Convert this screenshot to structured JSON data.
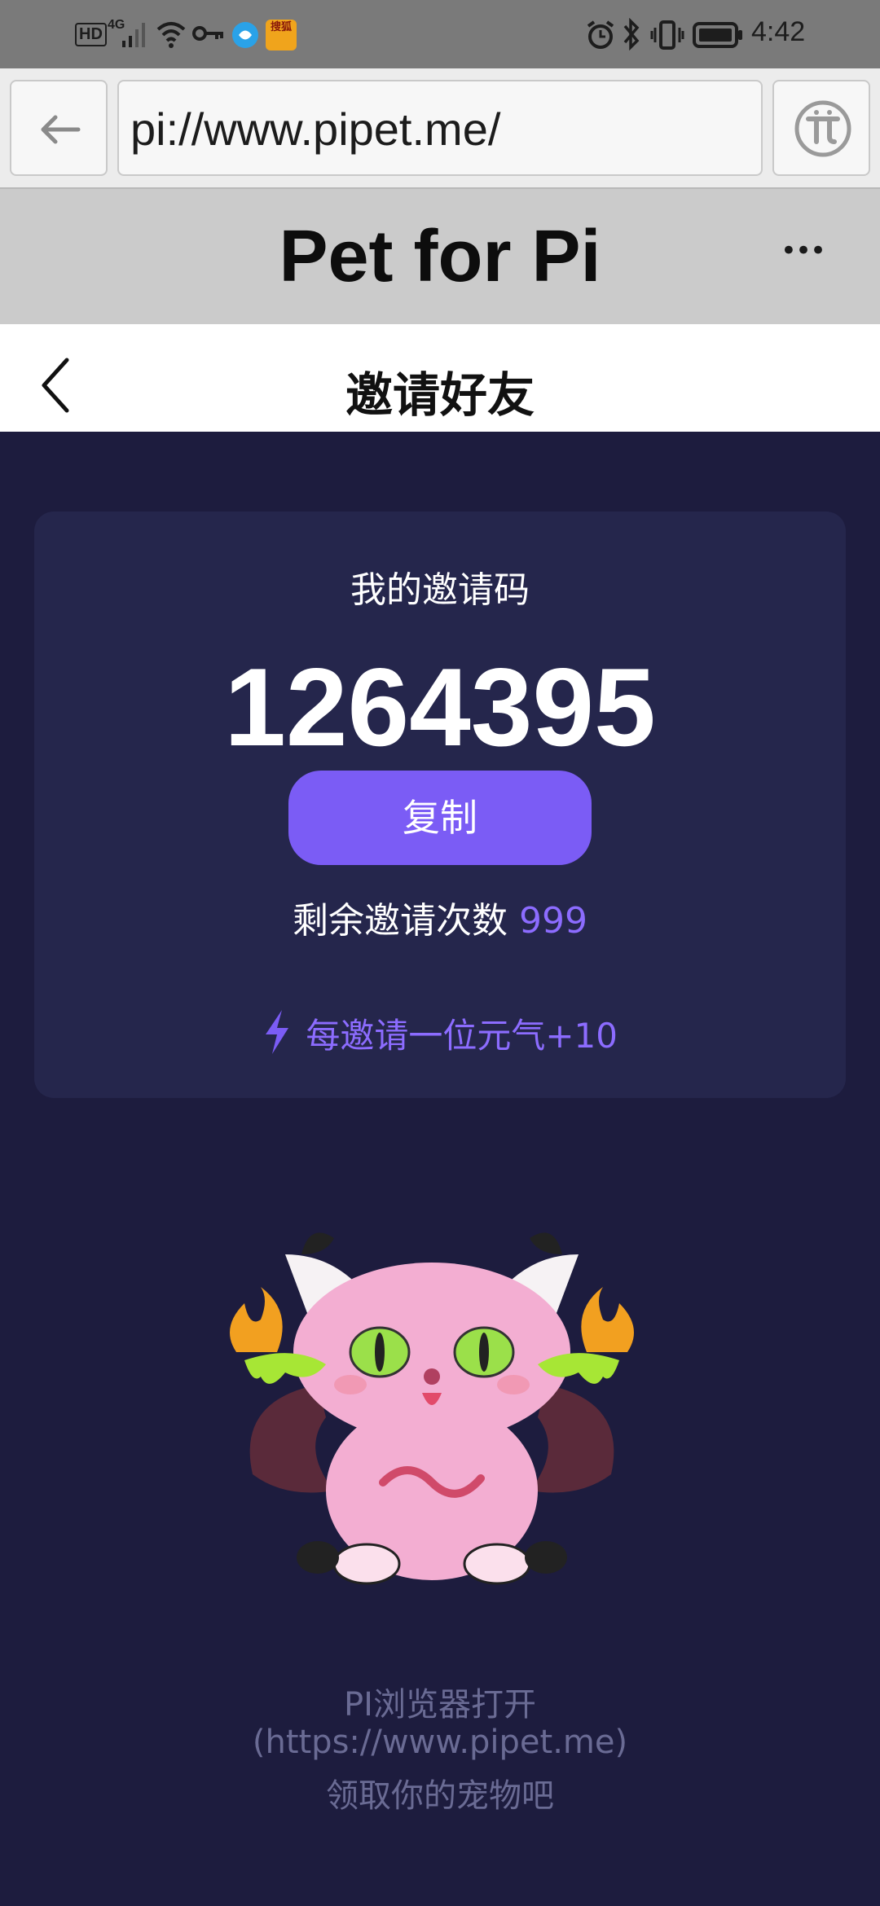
{
  "status_bar": {
    "hd": "HD",
    "network": "4G",
    "app_badge": "搜狐",
    "time": "4:42"
  },
  "browser": {
    "url": "pi://www.pipet.me/",
    "back_icon": "arrow-left-icon",
    "pi_icon": "pi-logo-icon"
  },
  "app": {
    "title": "Pet for Pi",
    "more": "•••"
  },
  "nav": {
    "title": "邀请好友",
    "back_icon": "chevron-left-icon"
  },
  "invite": {
    "label": "我的邀请码",
    "code": "1264395",
    "copy_label": "复制",
    "remaining_label": "剩余邀请次数",
    "remaining_count": "999",
    "reward_text": "每邀请一位元气+10"
  },
  "footer": {
    "line1": "PI浏览器打开",
    "line2": "(https://www.pipet.me)",
    "line3": "领取你的宠物吧"
  },
  "colors": {
    "accent": "#7b5cf5",
    "background": "#1d1c3e",
    "card": "#25264c"
  }
}
